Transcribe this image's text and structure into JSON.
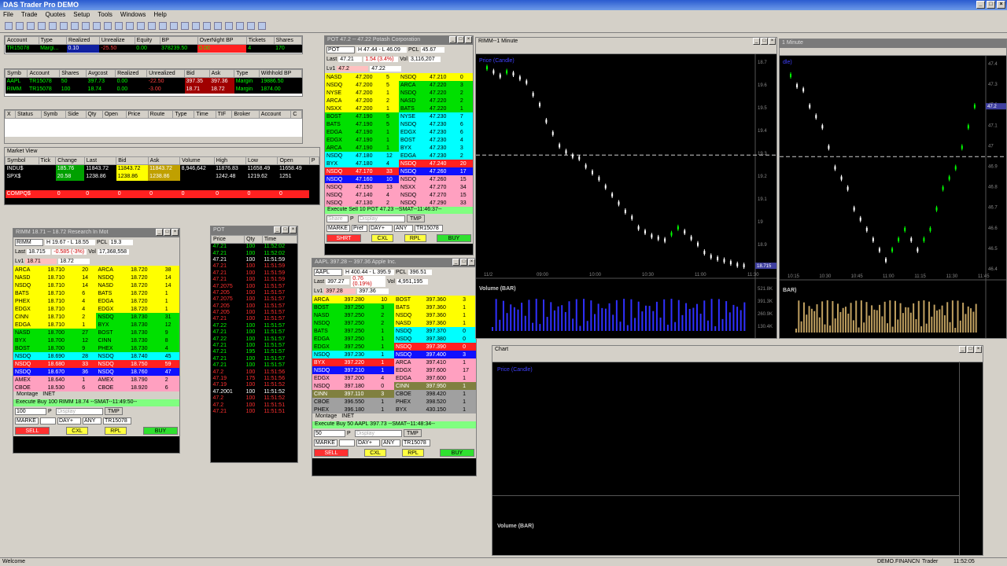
{
  "app": {
    "title": "DAS Trader Pro DEMO",
    "status_left": "Welcome",
    "status_acct": "DEMO.FINANCN",
    "status_role": "Trader",
    "status_time": "11:52:05"
  },
  "menu": [
    "File",
    "Trade",
    "Quotes",
    "Setup",
    "Tools",
    "Windows",
    "Help"
  ],
  "account": {
    "headers": [
      "Account",
      "Type",
      "Realized",
      "Unrealize",
      "Equity",
      "BP",
      "OverNight BP",
      "Tickets",
      "Shares"
    ],
    "row": [
      "TR15078",
      "Margi...",
      "0.10",
      "-25.50",
      "0.00",
      "378239.50",
      "0.00",
      "4",
      "170"
    ]
  },
  "positions": {
    "headers": [
      "Symb",
      "Account",
      "Shares",
      "Avgcost",
      "Realized",
      "Unrealized",
      "Bid",
      "Ask",
      "Type",
      "Withhold BP"
    ],
    "rows": [
      [
        "AAPL",
        "TR15078",
        "50",
        "397.73",
        "0.00",
        "-22.50",
        "397.35",
        "397.36",
        "Margin",
        "19886.50"
      ],
      [
        "RIMM",
        "TR15078",
        "100",
        "18.74",
        "0.00",
        "-3.00",
        "18.71",
        "18.72",
        "Margin",
        "1874.00"
      ]
    ]
  },
  "orders": {
    "headers": [
      "X",
      "Status",
      "Symb",
      "Side",
      "Qty",
      "Open",
      "Price",
      "Route",
      "Type",
      "Time",
      "TIF",
      "Broker",
      "Account",
      "C"
    ]
  },
  "market_view": {
    "title": "Market View",
    "headers": [
      "Symbol",
      "Tick",
      "Change",
      "Last",
      "Bid",
      "Ask",
      "Volume",
      "High",
      "Low",
      "Open",
      "P"
    ],
    "rows": [
      [
        "INDU$",
        "",
        "185.76",
        "11843.72",
        "11843.72",
        "11843.72",
        "8,946,642",
        "11876.83",
        "11658.49",
        "11658.49"
      ],
      [
        "SPX$",
        "",
        "20.58",
        "1238.86",
        "1238.86",
        "1238.86",
        "",
        "1242.48",
        "1219.62",
        "1251"
      ],
      [
        "COMPQ$",
        "",
        "0",
        "0",
        "0",
        "0",
        "0",
        "0",
        "0",
        "0"
      ]
    ]
  },
  "rimm": {
    "title": "RIMM   18.71 -- 18.72   Research In Mot",
    "symbol": "RIMM",
    "hl": "H 19.67 - L 18.55",
    "pcl_label": "PCL",
    "pcl": "19.3",
    "last_label": "Last",
    "last": "18.715",
    "chg": "-0.585  (-3%)",
    "vol_label": "Vol",
    "vol": "17,368,558",
    "lv1_label": "Lv1",
    "lv1a": "18.71",
    "lv1b": "18.72",
    "bids": [
      [
        "ARCA",
        "18.710",
        "20",
        "y"
      ],
      [
        "NASD",
        "18.710",
        "14",
        "y"
      ],
      [
        "NSDQ",
        "18.710",
        "14",
        "y"
      ],
      [
        "BATS",
        "18.710",
        "6",
        "y"
      ],
      [
        "PHEX",
        "18.710",
        "4",
        "y"
      ],
      [
        "EDGX",
        "18.710",
        "4",
        "y"
      ],
      [
        "CINN",
        "18.710",
        "2",
        "y"
      ],
      [
        "EDGA",
        "18.710",
        "1",
        "y"
      ],
      [
        "NASD",
        "18.700",
        "27",
        "g"
      ],
      [
        "BYX",
        "18.700",
        "12",
        "g"
      ],
      [
        "BOST",
        "18.700",
        "9",
        "g"
      ],
      [
        "NSDQ",
        "18.690",
        "28",
        "c"
      ],
      [
        "NSDQ",
        "18.680",
        "33",
        "r"
      ],
      [
        "NSDQ",
        "18.670",
        "36",
        "b"
      ],
      [
        "AMEX",
        "18.640",
        "1",
        "p"
      ],
      [
        "CBOE",
        "18.530",
        "6",
        "p"
      ]
    ],
    "asks": [
      [
        "ARCA",
        "18.720",
        "38",
        "y"
      ],
      [
        "NSDQ",
        "18.720",
        "14",
        "y"
      ],
      [
        "NASD",
        "18.720",
        "14",
        "y"
      ],
      [
        "BATS",
        "18.720",
        "1",
        "y"
      ],
      [
        "EDGA",
        "18.720",
        "1",
        "y"
      ],
      [
        "EDGX",
        "18.720",
        "1",
        "y"
      ],
      [
        "NSDQ",
        "18.730",
        "31",
        "g"
      ],
      [
        "BYX",
        "18.730",
        "12",
        "g"
      ],
      [
        "BOST",
        "18.730",
        "9",
        "g"
      ],
      [
        "CINN",
        "18.730",
        "8",
        "g"
      ],
      [
        "PHEX",
        "18.730",
        "4",
        "g"
      ],
      [
        "NSDQ",
        "18.740",
        "45",
        "c"
      ],
      [
        "NSDQ",
        "18.750",
        "59",
        "r"
      ],
      [
        "NSDQ",
        "18.760",
        "47",
        "b"
      ],
      [
        "AMEX",
        "18.790",
        "2",
        "p"
      ],
      [
        "CBOE",
        "18.920",
        "6",
        "p"
      ]
    ],
    "tabs": [
      "Montage",
      "INET"
    ],
    "exec": "Execute Buy 100 RIMM 18.74 --SMAT--11:49:50--",
    "qty": "100",
    "price": "Display",
    "route": "MARKE",
    "tif": "DAY+",
    "any": "ANY",
    "acct": "TR15078",
    "btn_sell": "SELL",
    "btn_cxl": "CXL",
    "btn_rpl": "RPL",
    "btn_buy": "BUY",
    "tmp": "TMP"
  },
  "ts": {
    "title": "POT",
    "headers": [
      "Price",
      "Qty",
      "Time"
    ],
    "rows": [
      [
        "47.21",
        "100",
        "11:52:02",
        "g"
      ],
      [
        "47.21",
        "100",
        "11:52:02",
        "g"
      ],
      [
        "47.21",
        "100",
        "11:51:59",
        "w"
      ],
      [
        "47.21",
        "100",
        "11:51:59",
        "r"
      ],
      [
        "47.21",
        "100",
        "11:51:59",
        "r"
      ],
      [
        "47.21",
        "100",
        "11:51:59",
        "r"
      ],
      [
        "47.2075",
        "100",
        "11:51:57",
        "r"
      ],
      [
        "47.205",
        "100",
        "11:51:57",
        "r"
      ],
      [
        "47.2075",
        "100",
        "11:51:57",
        "r"
      ],
      [
        "47.205",
        "100",
        "11:51:57",
        "r"
      ],
      [
        "47.205",
        "100",
        "11:51:57",
        "r"
      ],
      [
        "47.21",
        "100",
        "11:51:57",
        "r"
      ],
      [
        "47.22",
        "100",
        "11:51:57",
        "g"
      ],
      [
        "47.21",
        "100",
        "11:51:57",
        "g"
      ],
      [
        "47.22",
        "100",
        "11:51:57",
        "g"
      ],
      [
        "47.21",
        "100",
        "11:51:57",
        "g"
      ],
      [
        "47.21",
        "195",
        "11:51:57",
        "g"
      ],
      [
        "47.21",
        "100",
        "11:51:57",
        "g"
      ],
      [
        "47.21",
        "100",
        "11:51:57",
        "g"
      ],
      [
        "47.2",
        "100",
        "11:51:56",
        "r"
      ],
      [
        "47.19",
        "175",
        "11:51:56",
        "r"
      ],
      [
        "47.19",
        "100",
        "11:51:52",
        "r"
      ],
      [
        "47.2001",
        "100",
        "11:51:52",
        "w"
      ],
      [
        "47.2",
        "100",
        "11:51:52",
        "r"
      ],
      [
        "47.2",
        "100",
        "11:51:51",
        "r"
      ],
      [
        "47.21",
        "100",
        "11:51:51",
        "r"
      ]
    ]
  },
  "pot": {
    "title": "POT   47.2 -- 47.22   Potash Corporation",
    "symbol": "POT",
    "hl": "H 47.44 - L 46.09",
    "pcl_label": "PCL",
    "pcl": "45.67",
    "last_label": "Last",
    "last": "47.21",
    "chg": "1.54  (3.4%)",
    "vol_label": "Vol",
    "vol": "3,116,207",
    "lv1_label": "Lv1",
    "lv1a": "47.2",
    "lv1b": "47.22",
    "bids": [
      [
        "NASD",
        "47.200",
        "5",
        "y"
      ],
      [
        "NSDQ",
        "47.200",
        "5",
        "y"
      ],
      [
        "NYSE",
        "47.200",
        "1",
        "y"
      ],
      [
        "ARCA",
        "47.200",
        "2",
        "y"
      ],
      [
        "NSXX",
        "47.200",
        "1",
        "y"
      ],
      [
        "BOST",
        "47.190",
        "5",
        "g"
      ],
      [
        "BATS",
        "47.190",
        "5",
        "g"
      ],
      [
        "EDGA",
        "47.190",
        "1",
        "g"
      ],
      [
        "EDGX",
        "47.190",
        "1",
        "g"
      ],
      [
        "ARCA",
        "47.190",
        "1",
        "g"
      ],
      [
        "NSDQ",
        "47.180",
        "12",
        "c"
      ],
      [
        "BYX",
        "47.180",
        "4",
        "c"
      ],
      [
        "NSDQ",
        "47.170",
        "33",
        "r"
      ],
      [
        "NSDQ",
        "47.160",
        "10",
        "b"
      ],
      [
        "NSDQ",
        "47.150",
        "13",
        "p"
      ],
      [
        "NSDQ",
        "47.140",
        "4",
        "p"
      ],
      [
        "NSDQ",
        "47.130",
        "2",
        "p"
      ]
    ],
    "asks": [
      [
        "NSDQ",
        "47.210",
        "0",
        "y"
      ],
      [
        "ARCA",
        "47.220",
        "3",
        "g"
      ],
      [
        "NSDQ",
        "47.220",
        "2",
        "g"
      ],
      [
        "NASD",
        "47.220",
        "2",
        "g"
      ],
      [
        "BATS",
        "47.220",
        "1",
        "g"
      ],
      [
        "NYSE",
        "47.230",
        "7",
        "c"
      ],
      [
        "NSDQ",
        "47.230",
        "6",
        "c"
      ],
      [
        "EDGX",
        "47.230",
        "6",
        "c"
      ],
      [
        "BOST",
        "47.230",
        "4",
        "c"
      ],
      [
        "BYX",
        "47.230",
        "3",
        "c"
      ],
      [
        "EDGA",
        "47.230",
        "2",
        "c"
      ],
      [
        "NSDQ",
        "47.240",
        "20",
        "r"
      ],
      [
        "NSDQ",
        "47.260",
        "17",
        "b"
      ],
      [
        "NSDQ",
        "47.260",
        "15",
        "p"
      ],
      [
        "NSXX",
        "47.270",
        "34",
        "p"
      ],
      [
        "NSDQ",
        "47.270",
        "15",
        "p"
      ],
      [
        "NSDQ",
        "47.290",
        "33",
        "p"
      ]
    ],
    "exec": "Execute Sell 10 POT 47.23 --SMAT--11:46:37--",
    "qty": "",
    "price": "Display",
    "route": "MARKE",
    "tif": "DAY+",
    "any": "ANY",
    "acct": "TR15078",
    "btn_sell": "SHRT",
    "btn_cxl": "CXL",
    "btn_rpl": "RPL",
    "btn_buy": "BUY",
    "share": "Share",
    "pref": "Pref",
    "tmp": "TMP"
  },
  "aapl": {
    "title": "AAPL   397.28 -- 397.36   Apple Inc.",
    "symbol": "AAPL",
    "hl": "H 400.44 - L 395.9",
    "pcl_label": "PCL",
    "pcl": "396.51",
    "last_label": "Last",
    "last": "397.27",
    "chg": "0.76  (0.19%)",
    "vol_label": "Vol",
    "vol": "4,951,195",
    "lv1_label": "Lv1",
    "lv1a": "397.28",
    "lv1b": "397.36",
    "bids": [
      [
        "ARCA",
        "397.280",
        "10",
        "y"
      ],
      [
        "BOST",
        "397.250",
        "3",
        "g"
      ],
      [
        "NASD",
        "397.250",
        "2",
        "g"
      ],
      [
        "NSDQ",
        "397.250",
        "2",
        "g"
      ],
      [
        "BATS",
        "397.250",
        "1",
        "g"
      ],
      [
        "EDGA",
        "397.250",
        "1",
        "g"
      ],
      [
        "EDGX",
        "397.250",
        "1",
        "g"
      ],
      [
        "NSDQ",
        "397.230",
        "1",
        "c"
      ],
      [
        "BYX",
        "397.220",
        "1",
        "r"
      ],
      [
        "NSDQ",
        "397.210",
        "1",
        "b"
      ],
      [
        "EDGX",
        "397.200",
        "4",
        "p"
      ],
      [
        "NSDQ",
        "397.180",
        "0",
        "p"
      ],
      [
        "CINN",
        "397.110",
        "3",
        "o"
      ],
      [
        "CBOE",
        "396.550",
        "1",
        "gr"
      ],
      [
        "PHEX",
        "396.180",
        "1",
        "gr"
      ]
    ],
    "asks": [
      [
        "BOST",
        "397.360",
        "3",
        "y"
      ],
      [
        "BATS",
        "397.360",
        "1",
        "y"
      ],
      [
        "NSDQ",
        "397.360",
        "1",
        "y"
      ],
      [
        "NASD",
        "397.360",
        "1",
        "y"
      ],
      [
        "NSDQ",
        "397.370",
        "0",
        "c"
      ],
      [
        "NSDQ",
        "397.380",
        "0",
        "c"
      ],
      [
        "NSDQ",
        "397.390",
        "0",
        "r"
      ],
      [
        "NSDQ",
        "397.400",
        "3",
        "b"
      ],
      [
        "ARCA",
        "397.410",
        "1",
        "p"
      ],
      [
        "EDGX",
        "397.600",
        "17",
        "p"
      ],
      [
        "EDGA",
        "397.600",
        "1",
        "p"
      ],
      [
        "CINN",
        "397.950",
        "1",
        "o"
      ],
      [
        "CBOE",
        "398.420",
        "1",
        "gr"
      ],
      [
        "PHEX",
        "398.520",
        "1",
        "gr"
      ],
      [
        "BYX",
        "430.150",
        "1",
        "gr"
      ]
    ],
    "tabs": [
      "Montage",
      "INET"
    ],
    "exec": "Execute Buy 50 AAPL 397.73 --SMAT--11:48:34--",
    "qty": "50",
    "price": "Display",
    "route": "MARKE",
    "tif": "DAY+",
    "any": "ANY",
    "acct": "TR15078",
    "btn_sell": "SELL",
    "btn_cxl": "CXL",
    "btn_rpl": "RPL",
    "btn_buy": "BUY",
    "tmp": "TMP"
  },
  "chart1": {
    "title": "RIMM--1 Minute",
    "price_label": "Price (Candle)",
    "volume_label": "Volume (BAR)",
    "last_tag": "18.715",
    "xticks": [
      "11/2",
      "09:00",
      "10:00",
      "10:30",
      "11:00",
      "11:30"
    ],
    "yticks": [
      "18.7",
      "19.6",
      "19.5",
      "19.4",
      "19.3",
      "19.2",
      "19.1",
      "19",
      "18.9",
      "18.8"
    ],
    "vyticks": [
      "521.8K",
      "391.3K",
      "260.9K",
      "130.4K"
    ],
    "prices": [
      19.68,
      19.66,
      19.64,
      19.66,
      19.65,
      19.63,
      19.61,
      19.55,
      19.5,
      19.42,
      19.36,
      19.3,
      19.27,
      19.25,
      19.24,
      19.2,
      19.17,
      19.14,
      19.1,
      19.06,
      19.02,
      18.98,
      18.95,
      18.9,
      18.88,
      18.86,
      18.85,
      18.84,
      18.87,
      18.9,
      18.88,
      18.85,
      18.82,
      18.78,
      18.76,
      18.75,
      18.74,
      18.73,
      18.72,
      18.715
    ]
  },
  "chart2": {
    "title": "1 Minute",
    "price_label": "dle)",
    "volume_label": "BAR)",
    "last_tag": "47.2",
    "xticks": [
      "10:15",
      "10:30",
      "10:45",
      "11:00",
      "11:15",
      "11:30",
      "11:45"
    ],
    "yticks": [
      "47.4",
      "47.3",
      "47.2",
      "47.1",
      "47",
      "46.9",
      "46.8",
      "46.7",
      "46.6",
      "46.5",
      "46.4"
    ],
    "prices": [
      47.35,
      47.3,
      47.28,
      47.2,
      47.15,
      47.1,
      47.0,
      46.9,
      46.85,
      46.8,
      46.7,
      46.65,
      46.6,
      46.55,
      46.5,
      46.45,
      46.5,
      46.55,
      46.6,
      46.55,
      46.5,
      46.55,
      46.6,
      46.7,
      46.8,
      46.85,
      46.9,
      47.0,
      47.1,
      47.2
    ]
  },
  "chart3": {
    "title": "Chart",
    "price_label": "Price (Candle)",
    "volume_label": "Volume (BAR)"
  }
}
